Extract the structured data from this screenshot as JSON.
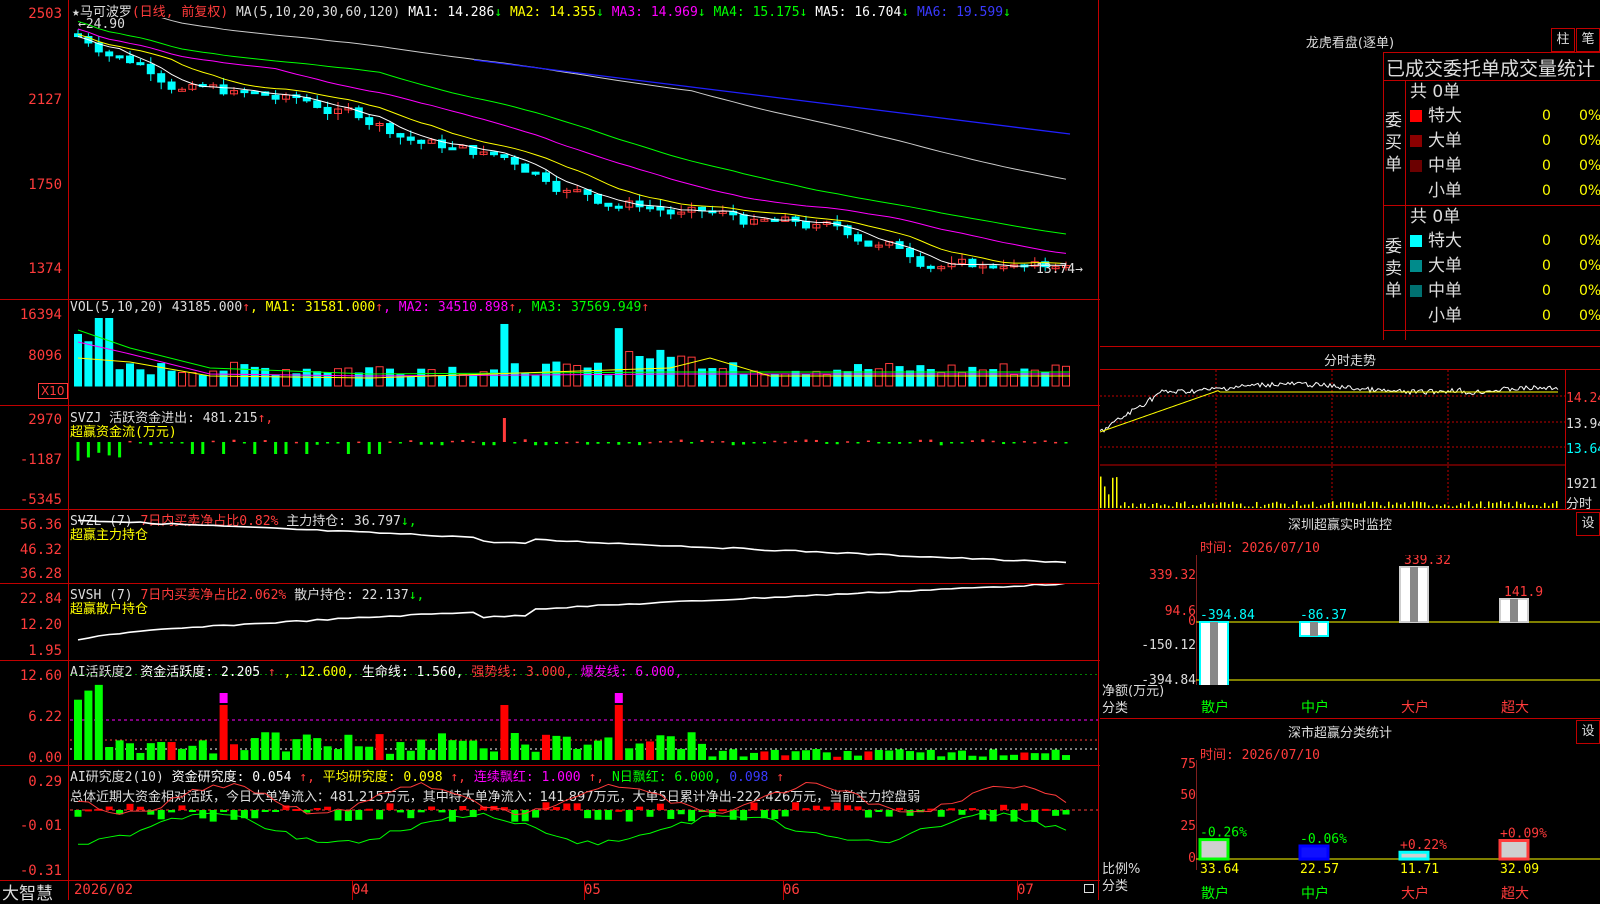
{
  "chart_panels": {
    "kline": {
      "header": {
        "star": "★",
        "name": "马可波罗",
        "mode": "(日线, 前复权)",
        "ma_label": "MA(5,10,20,30,60,120)",
        "items": [
          {
            "k": "MA1: ",
            "v": "14.286",
            "arrow": "↓",
            "color": "#ffffff"
          },
          {
            "k": "MA2: ",
            "v": "14.355",
            "arrow": "↓",
            "color": "#ffff00"
          },
          {
            "k": "MA3: ",
            "v": "14.969",
            "arrow": "↓",
            "color": "#ff00ff"
          },
          {
            "k": "MA4: ",
            "v": "15.175",
            "arrow": "↓",
            "color": "#00ff00"
          },
          {
            "k": "MA5: ",
            "v": "16.704",
            "arrow": "↓",
            "color": "#ffffff"
          },
          {
            "k": "MA6: ",
            "v": "19.599",
            "arrow": "↓",
            "color": "#3a3aff"
          }
        ]
      },
      "y_ticks": [
        "2503",
        "2127",
        "1750",
        "1374"
      ],
      "high_label": "24.90",
      "low_label": "13.74",
      "colors": {
        "up": "#ff3b3b",
        "down": "#00ffff",
        "ma1": "#ffffff",
        "ma2": "#ffff00",
        "ma3": "#ff00ff",
        "ma4": "#00ff00",
        "ma5": "#cccccc",
        "ma6": "#2020ff"
      }
    },
    "vol": {
      "header": {
        "k": "VOL(5,10,20)",
        "v": "43185.000",
        "arrow": "↑",
        "items": [
          {
            "k": "MA1: ",
            "v": "31581.000",
            "arrow": "↑",
            "color": "#ffff00"
          },
          {
            "k": "MA2: ",
            "v": "34510.898",
            "arrow": "↑",
            "color": "#ff00ff"
          },
          {
            "k": "MA3: ",
            "v": "37569.949",
            "arrow": "↑",
            "color": "#00ff00"
          }
        ]
      },
      "y_ticks": [
        "16394",
        "8096"
      ],
      "unit": "X10"
    },
    "svzj": {
      "header_k": "SVZJ",
      "header_t": "活跃资金进出:",
      "header_v": "481.215",
      "header_arrow": "↑,",
      "sub": "超赢资金流(万元)",
      "y_ticks": [
        "2970",
        "-1187",
        "-5345"
      ]
    },
    "svzl": {
      "header_k": "SVZL (7)",
      "header_t1": "7日内买卖净占比0.82%",
      "header_t2": "主力持仓:",
      "header_v": "36.797",
      "header_arrow": "↓,",
      "sub": "超赢主力持仓",
      "y_ticks": [
        "56.36",
        "46.32",
        "36.28"
      ]
    },
    "svsh": {
      "header_k": "SVSH (7)",
      "header_t1": "7日内买卖净占比2.062%",
      "header_t2": "散户持仓:",
      "header_v": "22.137",
      "header_arrow": "↓,",
      "sub": "超赢散户持仓",
      "y_ticks": [
        "22.84",
        "12.20",
        "1.95"
      ]
    },
    "ai1": {
      "header_k": "AI活跃度2",
      "header_items": [
        {
          "t": "资金活跃度: 2.205",
          "c": "#ffffff"
        },
        {
          "t": "↑",
          "c": "#ff3b3b"
        },
        {
          "t": ", 12.600,",
          "c": "#ffff00"
        },
        {
          "t": " 生命线: 1.560,",
          "c": "#ffffff"
        },
        {
          "t": " 强势线: 3.000,",
          "c": "#ff3b3b"
        },
        {
          "t": " 爆发线: 6.000,",
          "c": "#ff00ff"
        }
      ],
      "y_ticks": [
        "12.60",
        "6.22",
        "0.00"
      ]
    },
    "ai2": {
      "header_k": "AI研究度2(10)",
      "header_items": [
        {
          "t": "资金研究度: 0.054",
          "c": "#ffffff"
        },
        {
          "t": "↑,",
          "c": "#ff3b3b"
        },
        {
          "t": " 平均研究度: 0.098",
          "c": "#ffff00"
        },
        {
          "t": "↑,",
          "c": "#ff3b3b"
        },
        {
          "t": " 连续飘红: 1.000",
          "c": "#ff00ff"
        },
        {
          "t": "↑,",
          "c": "#ff3b3b"
        },
        {
          "t": " N日飘红: 6.000,",
          "c": "#00ff00"
        },
        {
          "t": " 0.098",
          "c": "#3a3aff"
        },
        {
          "t": "↑",
          "c": "#ff3b3b"
        }
      ],
      "summary": "总体近期大资金相对活跃，今日大单净流入：481.215万元，其中特大单净流入：141.897万元，大单5日累计净出-222.426万元，当前主力控盘弱",
      "y_ticks": [
        "0.29",
        "-0.01",
        "-0.31"
      ]
    }
  },
  "bottom_bar": {
    "logo": "大智慧",
    "dates": [
      "2026/02",
      "04",
      "05",
      "06",
      "07"
    ]
  },
  "dragon_tiger": {
    "title": "龙虎看盘(逐单)",
    "btn_bar": "柱",
    "btn_pen": "笔",
    "header": "已成交委托单成交量统计",
    "buy_side_label": "委买单",
    "sell_side_label": "委卖单",
    "buy_total": "共 0单",
    "sell_total": "共 0单",
    "buy_rows": [
      {
        "label": "特大",
        "val": "0",
        "pct": "0%",
        "color": "#ff0000"
      },
      {
        "label": "大单",
        "val": "0",
        "pct": "0%",
        "color": "#8b0000"
      },
      {
        "label": "中单",
        "val": "0",
        "pct": "0%",
        "color": "#6b0000"
      },
      {
        "label": "小单",
        "val": "0",
        "pct": "0%",
        "color": ""
      }
    ],
    "sell_rows": [
      {
        "label": "特大",
        "val": "0",
        "pct": "0%",
        "color": "#00ffff"
      },
      {
        "label": "大单",
        "val": "0",
        "pct": "0%",
        "color": "#008b8b"
      },
      {
        "label": "中单",
        "val": "0",
        "pct": "0%",
        "color": "#007070"
      },
      {
        "label": "小单",
        "val": "0",
        "pct": "0%",
        "color": ""
      }
    ]
  },
  "intraday": {
    "title": "分时走势",
    "y_ticks": [
      "14.24",
      "13.94",
      "13.64"
    ],
    "vol_tick": "1921",
    "vol_label": "分时"
  },
  "monitor": {
    "title": "深圳超赢实时监控",
    "btn": "设",
    "time": "时间: 2026/07/10",
    "y_ticks": [
      "339.32",
      "94.6",
      "0",
      "-150.12",
      "-394.84"
    ],
    "bottom_label_1": "净额(万元)",
    "bottom_label_2": "分类",
    "categories": [
      "散户",
      "中户",
      "大户",
      "超大"
    ],
    "values": [
      -394.84,
      -86.37,
      339.32,
      141.9
    ],
    "value_labels": [
      "-394.84",
      "-86.37",
      "339.32",
      "141.9"
    ]
  },
  "classify": {
    "title": "深市超赢分类统计",
    "btn": "设",
    "time": "时间: 2026/07/10",
    "y_ticks": [
      "75",
      "50",
      "25",
      "0"
    ],
    "bottom_label_1": "比例%",
    "bottom_label_2": "分类",
    "categories": [
      "散户",
      "中户",
      "大户",
      "超大"
    ],
    "values": [
      33.64,
      22.57,
      11.71,
      32.09
    ],
    "value_labels": [
      "33.64",
      "22.57",
      "11.71",
      "32.09"
    ],
    "changes": [
      "-0.26%",
      "-0.06%",
      "+0.22%",
      "+0.09%"
    ]
  }
}
